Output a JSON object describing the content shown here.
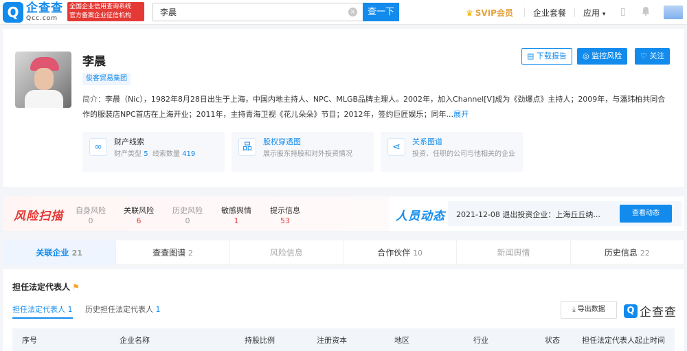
{
  "header": {
    "logo_cn": "企查查",
    "logo_en": "Qcc.com",
    "badge_line1": "全国企业信用查询系统",
    "badge_line2": "官方备案企业征信机构",
    "search_value": "李晨",
    "search_button": "查一下",
    "svip": "SVIP会员",
    "package": "企业套餐",
    "apps": "应用",
    "colors": {
      "primary": "#128bed",
      "danger": "#e53935",
      "gold": "#e6a23c"
    }
  },
  "profile": {
    "name": "李晨",
    "tag": "俊客贸易集团",
    "bio_label": "简介：",
    "bio_text": "李晨（Nic），1982年8月28日出生于上海，中国内地主持人、NPC、MLGB品牌主理人。2002年，加入Channel[V]成为《劲爆点》主持人；2009年，与潘玮柏共同合作的服装店NPC首店在上海开业；2011年，主持青海卫视《花儿朵朵》节目；2012年，签约巨匠娱乐；同年...",
    "bio_more": "展开",
    "buttons": {
      "download": "下载报告",
      "monitor": "监控风险",
      "follow": "关注"
    },
    "features": [
      {
        "title": "财产线索",
        "desc_prefix1": "财产类型",
        "value1": "5",
        "desc_prefix2": "线索数量",
        "value2": "419"
      },
      {
        "title": "股权穿透图",
        "desc": "展示股东持股和对外投资情况"
      },
      {
        "title": "关系图谱",
        "desc": "投资、任职的公司与他相关的企业"
      }
    ]
  },
  "risk": {
    "title": "风险扫描",
    "items": [
      {
        "label": "自身风险",
        "value": "0"
      },
      {
        "label": "关联风险",
        "value": "6"
      },
      {
        "label": "历史风险",
        "value": "0"
      },
      {
        "label": "敏感舆情",
        "value": "1"
      },
      {
        "label": "提示信息",
        "value": "53"
      }
    ],
    "people_title": "人员动态",
    "people_text": "2021-12-08 退出投资企业：上海丘丘纳...",
    "people_button": "查看动态"
  },
  "tabs": [
    {
      "label": "关联企业",
      "count": "21"
    },
    {
      "label": "查查图谱",
      "count": "2"
    },
    {
      "label": "风险信息",
      "count": ""
    },
    {
      "label": "合作伙伴",
      "count": "10"
    },
    {
      "label": "新闻舆情",
      "count": ""
    },
    {
      "label": "历史信息",
      "count": "22"
    }
  ],
  "section": {
    "title": "担任法定代表人",
    "subtab1_label": "担任法定代表人",
    "subtab1_count": "1",
    "subtab2_label": "历史担任法定代表人",
    "subtab2_count": "1",
    "export": "导出数据",
    "brand": "企查查",
    "columns": [
      "序号",
      "企业名称",
      "持股比例",
      "注册资本",
      "地区",
      "行业",
      "状态",
      "担任法定代表人起止时间"
    ]
  }
}
